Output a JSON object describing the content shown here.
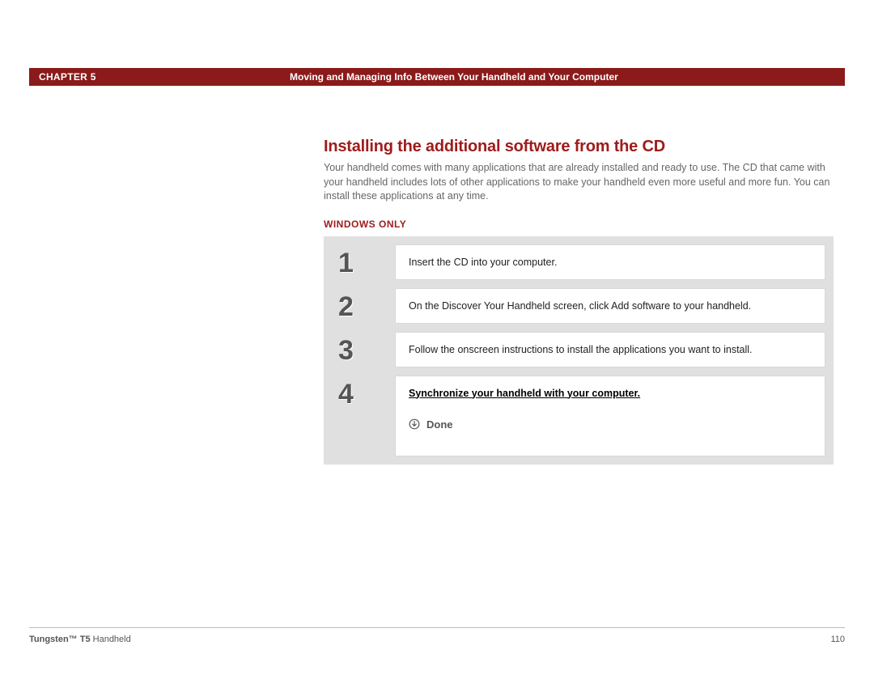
{
  "header": {
    "chapter": "CHAPTER 5",
    "title": "Moving and Managing Info Between Your Handheld and Your Computer"
  },
  "section": {
    "title": "Installing the additional software from the CD",
    "intro": "Your handheld comes with many applications that are already installed and ready to use. The CD that came with your handheld includes lots of other applications to make your handheld even more useful and more fun. You can install these applications at any time.",
    "platform_label": "WINDOWS ONLY"
  },
  "steps": [
    {
      "num": "1",
      "text": "Insert the CD into your computer."
    },
    {
      "num": "2",
      "text": "On the Discover Your Handheld screen, click Add software to your handheld."
    },
    {
      "num": "3",
      "text": "Follow the onscreen instructions to install the applications you want to install."
    },
    {
      "num": "4",
      "link_text": "Synchronize your handheld with your computer.",
      "done_label": "Done"
    }
  ],
  "footer": {
    "product_bold": "Tungsten™ T5",
    "product_rest": " Handheld",
    "page_number": "110"
  }
}
